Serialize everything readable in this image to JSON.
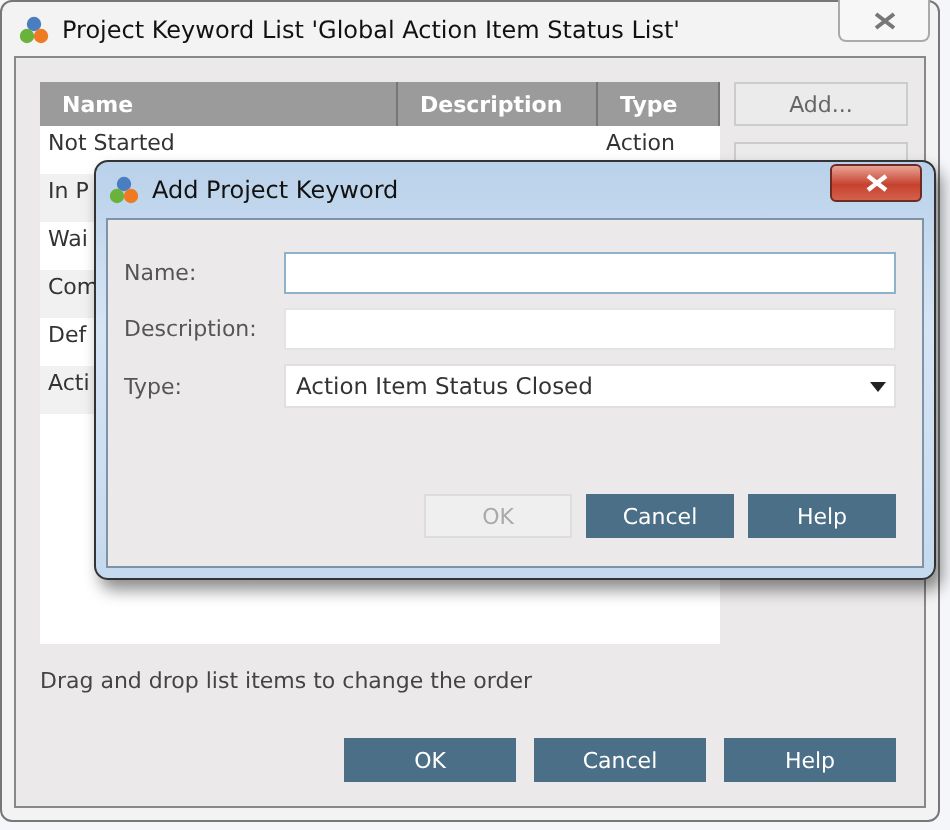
{
  "window": {
    "title": "Project Keyword List 'Global Action Item Status List'"
  },
  "table": {
    "columns": [
      "Name",
      "Description",
      "Type"
    ],
    "rows": [
      {
        "name": "Not Started",
        "type": "Action"
      },
      {
        "name": "In P"
      },
      {
        "name": "Wai"
      },
      {
        "name": "Com"
      },
      {
        "name": "Def"
      },
      {
        "name": "Acti"
      }
    ]
  },
  "side_buttons": [
    {
      "label": "Add..."
    }
  ],
  "hint": "Drag and drop list items to change the order",
  "buttons": [
    {
      "label": "OK",
      "disabled": false
    },
    {
      "label": "Cancel",
      "disabled": false
    },
    {
      "label": "Help",
      "disabled": false
    }
  ],
  "dialog": {
    "title": "Add Project Keyword",
    "fields": [
      {
        "kind": "text",
        "label": "Name:",
        "focused": true
      },
      {
        "kind": "text",
        "label": "Description:",
        "focused": false
      },
      {
        "kind": "select",
        "label": "Type:",
        "value": "Action Item Status Closed",
        "focused": false
      }
    ],
    "buttons": [
      {
        "label": "OK",
        "disabled": true
      },
      {
        "label": "Cancel",
        "disabled": false
      },
      {
        "label": "Help",
        "disabled": false
      }
    ]
  }
}
